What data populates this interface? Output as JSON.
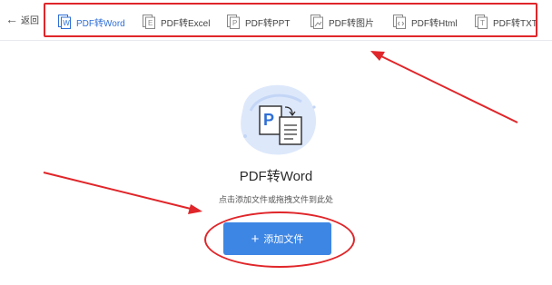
{
  "header": {
    "back_label": "返回",
    "tabs": [
      {
        "label": "PDF转Word",
        "active": true
      },
      {
        "label": "PDF转Excel",
        "active": false
      },
      {
        "label": "PDF转PPT",
        "active": false
      },
      {
        "label": "PDF转图片",
        "active": false
      },
      {
        "label": "PDF转Html",
        "active": false
      },
      {
        "label": "PDF转TXT",
        "active": false
      }
    ]
  },
  "main": {
    "title": "PDF转Word",
    "hint": "点击添加文件或拖拽文件到此处",
    "add_button_label": "添加文件",
    "add_button_icon": "plus-icon"
  },
  "colors": {
    "accent": "#2f6fd6",
    "button": "#3e86e4",
    "annotation": "#e0262a"
  }
}
